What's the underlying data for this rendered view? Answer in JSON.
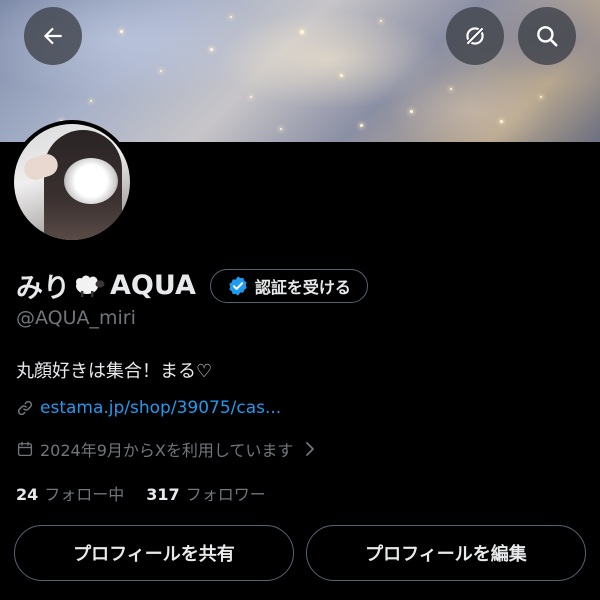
{
  "header": {
    "back_icon": "arrow-left-icon",
    "sync_icon": "sync-off-icon",
    "search_icon": "search-icon"
  },
  "profile": {
    "display_name": "みり",
    "name_emoji": "sheep-icon",
    "display_name_suffix": "AQUA",
    "verify_label": "認証を受ける",
    "verify_icon": "verified-badge-icon",
    "badge_color": "#1d9bf0",
    "handle": "@AQUA_miri",
    "bio": "丸顔好きは集合！まる♡",
    "link": "estama.jp/shop/39075/cas...",
    "joined": "2024年9月からXを利用しています",
    "following_count": "24",
    "following_label": "フォロー中",
    "followers_count": "317",
    "followers_label": "フォロワー"
  },
  "actions": {
    "share_label": "プロフィールを共有",
    "edit_label": "プロフィールを編集"
  },
  "colors": {
    "background": "#000000",
    "text_primary": "#e7e9ea",
    "text_secondary": "#71767b",
    "link": "#1d9bf0",
    "border": "#536471"
  }
}
